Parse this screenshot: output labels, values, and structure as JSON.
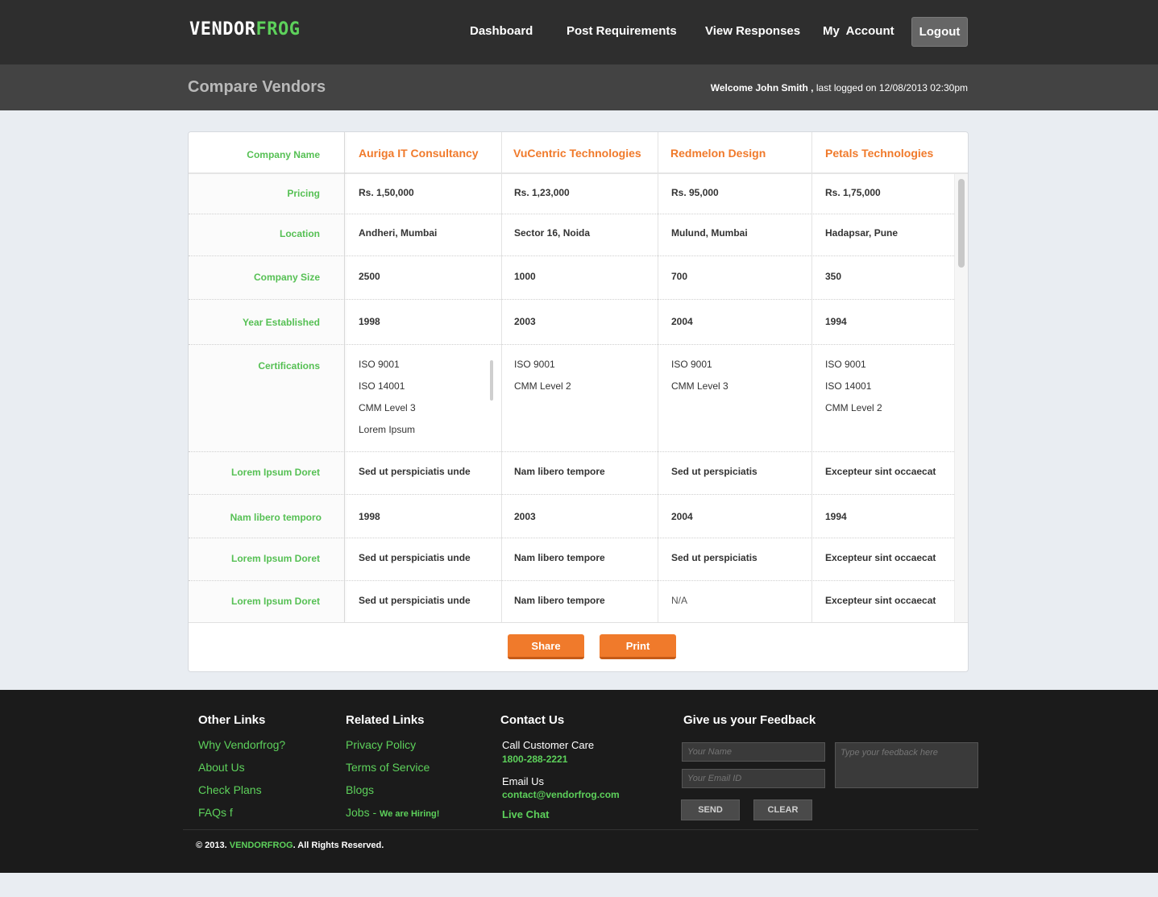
{
  "brand": {
    "part1": "VENDOR",
    "part2": "FROG"
  },
  "nav": {
    "items": [
      "Dashboard",
      "Post Requirements",
      "View Responses",
      "My  Account"
    ],
    "logout": "Logout"
  },
  "subheader": {
    "title": "Compare Vendors",
    "welcome_name": "Welcome John Smith ,",
    "welcome_rest": " last logged on 12/08/2013  02:30pm"
  },
  "compare": {
    "company_label": "Company Name",
    "vendors": [
      "Auriga IT Consultancy",
      "VuCentric Technologies",
      "Redmelon Design",
      "Petals Technologies"
    ],
    "rows": [
      {
        "label": "Pricing",
        "values": [
          "Rs. 1,50,000",
          "Rs. 1,23,000",
          "Rs. 95,000",
          "Rs. 1,75,000"
        ]
      },
      {
        "label": "Location",
        "values": [
          "Andheri, Mumbai",
          "Sector 16, Noida",
          "Mulund, Mumbai",
          "Hadapsar, Pune"
        ]
      },
      {
        "label": "Company Size",
        "values": [
          "2500",
          "1000",
          "700",
          "350"
        ]
      },
      {
        "label": "Year Established",
        "values": [
          "1998",
          "2003",
          "2004",
          "1994"
        ]
      },
      {
        "label": "Certifications",
        "certs": [
          [
            "ISO 9001",
            "ISO 14001",
            "CMM Level 3",
            "Lorem Ipsum"
          ],
          [
            "ISO 9001",
            "CMM Level 2"
          ],
          [
            "ISO 9001",
            "CMM Level 3"
          ],
          [
            "ISO 9001",
            "ISO 14001",
            "CMM Level 2"
          ]
        ]
      },
      {
        "label": "Lorem Ipsum Doret",
        "values": [
          "Sed ut perspiciatis unde",
          "Nam libero tempore",
          "Sed ut perspiciatis",
          "Excepteur sint occaecat"
        ]
      },
      {
        "label": "Nam libero temporo",
        "values": [
          "1998",
          "2003",
          "2004",
          "1994"
        ]
      },
      {
        "label": "Lorem Ipsum Doret",
        "values": [
          "Sed ut perspiciatis unde",
          "Nam libero tempore",
          "Sed ut perspiciatis",
          "Excepteur sint occaecat"
        ]
      },
      {
        "label": "Lorem Ipsum Doret",
        "values": [
          "Sed ut perspiciatis unde",
          "Nam libero tempore",
          "N/A",
          "Excepteur sint occaecat"
        ]
      }
    ],
    "share_label": "Share",
    "print_label": "Print"
  },
  "footer": {
    "other_links": {
      "title": "Other Links",
      "items": [
        "Why Vendorfrog?",
        "About Us",
        "Check Plans",
        "FAQs f"
      ]
    },
    "related_links": {
      "title": "Related Links",
      "items": [
        "Privacy Policy",
        "Terms of Service",
        "Blogs"
      ],
      "jobs": "Jobs - ",
      "jobs_hiring": "We are Hiring!"
    },
    "contact": {
      "title": "Contact Us",
      "care_label": "Call Customer Care",
      "care_phone": "1800-288-2221",
      "email_label": "Email Us",
      "email": "contact@vendorfrog.com",
      "chat": "Live Chat"
    },
    "feedback": {
      "title": "Give us your Feedback",
      "name_placeholder": "Your Name",
      "email_placeholder": "Your Email ID",
      "feedback_placeholder": "Type your feedback here",
      "send": "SEND",
      "clear": "CLEAR"
    },
    "copyright_pre": "© 2013. ",
    "copyright_brand": "VENDORFROG",
    "copyright_post": ". All Rights Reserved."
  }
}
